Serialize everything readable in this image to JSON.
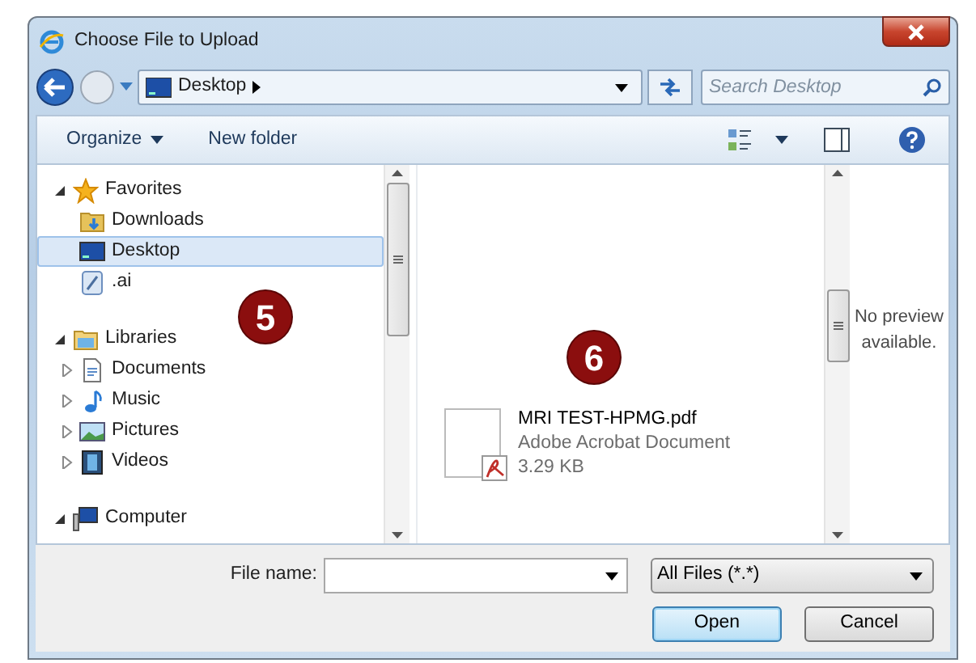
{
  "window": {
    "title": "Choose File to Upload"
  },
  "address": {
    "path": "Desktop"
  },
  "search": {
    "placeholder": "Search Desktop"
  },
  "toolbar": {
    "organize": "Organize",
    "new_folder": "New folder"
  },
  "nav_tree": [
    {
      "label": "Favorites",
      "expanded": true,
      "selected": false,
      "children": [
        {
          "label": "Downloads",
          "selected": false
        },
        {
          "label": "Desktop",
          "selected": true
        },
        {
          "label": ".ai",
          "selected": false
        }
      ]
    },
    {
      "label": "Libraries",
      "expanded": true,
      "selected": false,
      "children": [
        {
          "label": "Documents",
          "expanded": false,
          "selected": false
        },
        {
          "label": "Music",
          "expanded": false,
          "selected": false
        },
        {
          "label": "Pictures",
          "expanded": false,
          "selected": false
        },
        {
          "label": "Videos",
          "expanded": false,
          "selected": false
        }
      ]
    },
    {
      "label": "Computer",
      "expanded": true,
      "selected": false
    }
  ],
  "callouts": [
    "5",
    "6"
  ],
  "files": [
    {
      "name": "MRI TEST-HPMG.pdf",
      "type": "Adobe Acrobat Document",
      "size": "3.29 KB"
    }
  ],
  "preview": {
    "text": "No preview available."
  },
  "file_name": {
    "label": "File name:"
  },
  "filter": {
    "value": "All Files (*.*)"
  },
  "buttons": [
    {
      "label": "Open",
      "default": true
    },
    {
      "label": "Cancel",
      "default": false
    }
  ]
}
